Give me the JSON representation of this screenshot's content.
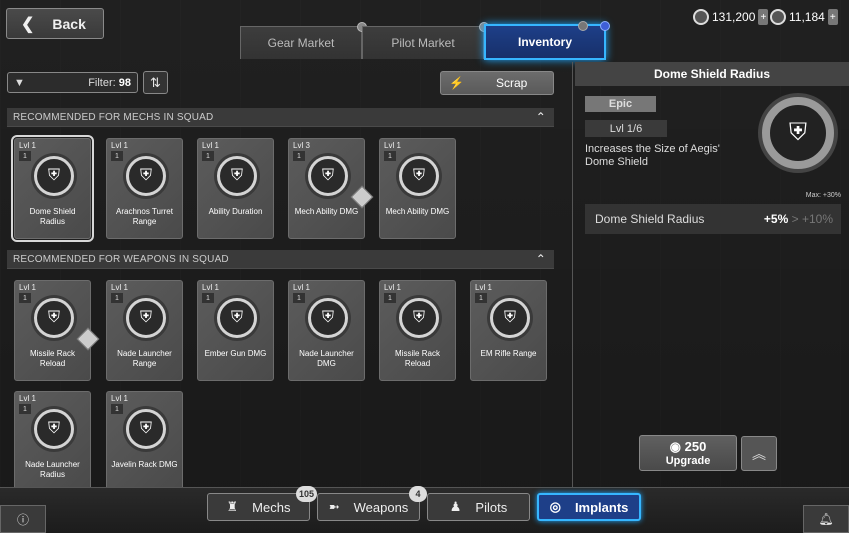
{
  "header": {
    "back_label": "Back",
    "currency1": "131,200",
    "currency2": "11,184"
  },
  "tabs": [
    {
      "label": "Gear Market"
    },
    {
      "label": "Pilot Market"
    },
    {
      "label": "Inventory"
    }
  ],
  "toolbar": {
    "filter_label": "Filter:",
    "filter_count": "98",
    "scrap_label": "Scrap"
  },
  "sections": {
    "mechs_header": "RECOMMENDED FOR MECHS IN SQUAD",
    "weapons_header": "RECOMMENDED FOR WEAPONS IN SQUAD"
  },
  "mech_cards": [
    {
      "lvl": "Lvl 1",
      "num": "1",
      "name": "Dome Shield Radius"
    },
    {
      "lvl": "Lvl 1",
      "num": "1",
      "name": "Arachnos Turret Range"
    },
    {
      "lvl": "Lvl 1",
      "num": "1",
      "name": "Ability Duration"
    },
    {
      "lvl": "Lvl 3",
      "num": "1",
      "name": "Mech Ability DMG"
    },
    {
      "lvl": "Lvl 1",
      "num": "1",
      "name": "Mech Ability DMG"
    }
  ],
  "weapon_cards": [
    {
      "lvl": "Lvl 1",
      "num": "1",
      "name": "Missile Rack Reload"
    },
    {
      "lvl": "Lvl 1",
      "num": "1",
      "name": "Nade Launcher Range"
    },
    {
      "lvl": "Lvl 1",
      "num": "1",
      "name": "Ember Gun DMG"
    },
    {
      "lvl": "Lvl 1",
      "num": "1",
      "name": "Nade Launcher DMG"
    },
    {
      "lvl": "Lvl 1",
      "num": "1",
      "name": "Missile Rack Reload"
    },
    {
      "lvl": "Lvl 1",
      "num": "1",
      "name": "EM Rifle Range"
    },
    {
      "lvl": "Lvl 1",
      "num": "1",
      "name": "Nade Launcher Radius"
    },
    {
      "lvl": "Lvl 1",
      "num": "1",
      "name": "Javelin Rack DMG"
    }
  ],
  "detail": {
    "title": "Dome Shield Radius",
    "rarity": "Epic",
    "level": "Lvl 1/6",
    "description": "Increases the Size of Aegis' Dome Shield",
    "max_note": "Max: +30%",
    "stat_name": "Dome Shield Radius",
    "stat_current": "+5%",
    "stat_arrow": ">",
    "stat_next": "+10%",
    "upgrade_cost": "250",
    "upgrade_label": "Upgrade"
  },
  "bottom_tabs": [
    {
      "label": "Mechs",
      "count": "105"
    },
    {
      "label": "Weapons",
      "count": "4"
    },
    {
      "label": "Pilots"
    },
    {
      "label": "Implants"
    }
  ],
  "colors": {
    "accent": "#36b6ff",
    "active_bg": "#1e3f88"
  }
}
